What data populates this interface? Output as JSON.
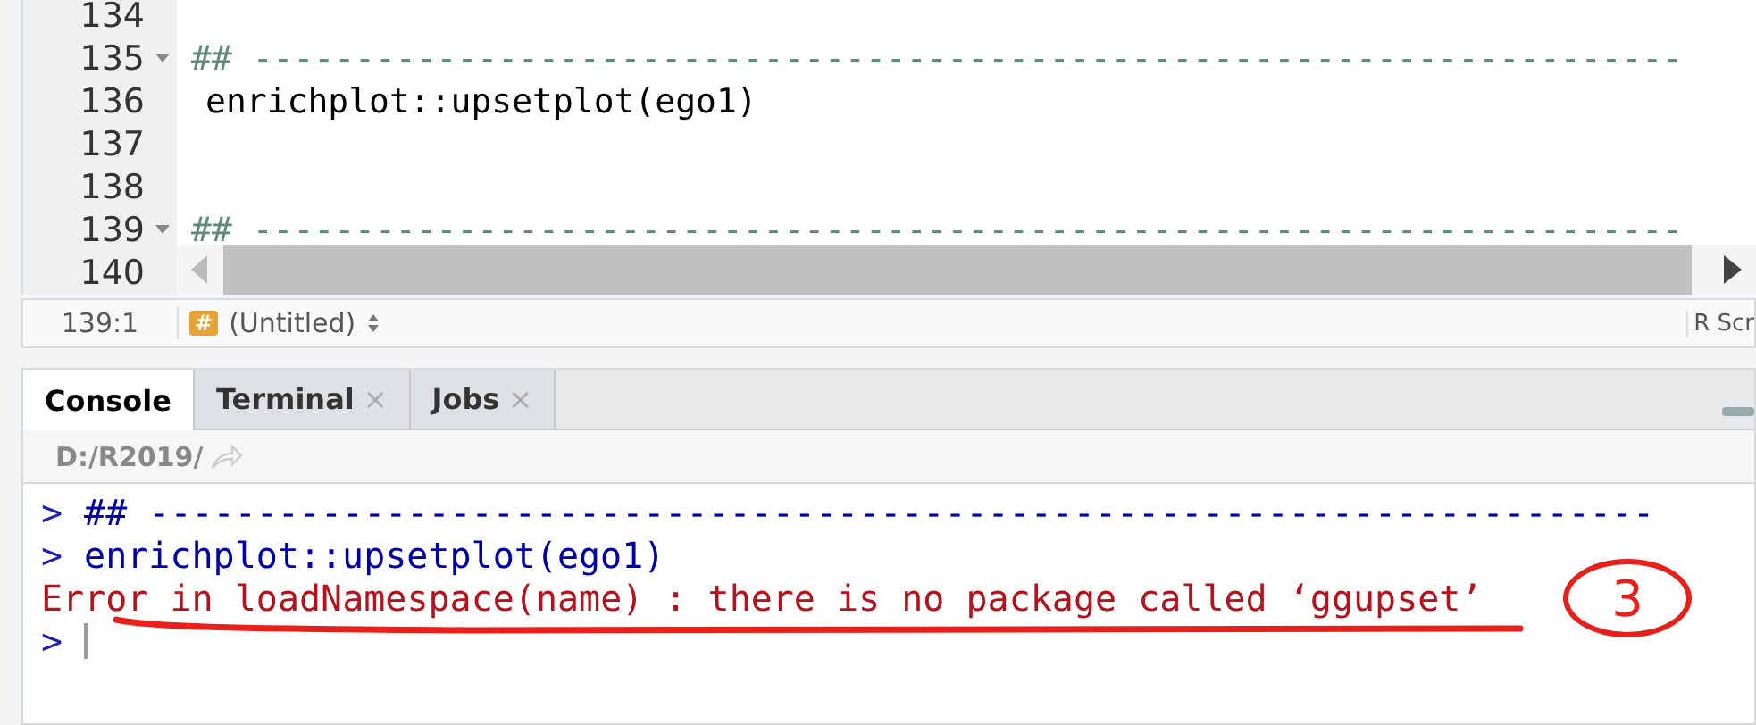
{
  "editor": {
    "lines": [
      {
        "number": "134",
        "foldable": false
      },
      {
        "number": "135",
        "foldable": true,
        "code": "## ----------------------------------------------------------------------",
        "kind": "comment"
      },
      {
        "number": "136",
        "foldable": false,
        "code": "enrichplot::upsetplot(ego1)",
        "kind": "code"
      },
      {
        "number": "137",
        "foldable": false
      },
      {
        "number": "138",
        "foldable": false
      },
      {
        "number": "139",
        "foldable": true,
        "code": "## ----------------------------------------------------------------------",
        "kind": "comment"
      },
      {
        "number": "140",
        "foldable": false
      }
    ]
  },
  "status_bar": {
    "position": "139:1",
    "scope_icon": "#",
    "scope": "(Untitled)",
    "file_type": "R Scr"
  },
  "console": {
    "tabs": [
      {
        "label": "Console",
        "selected": true,
        "closable": false
      },
      {
        "label": "Terminal",
        "selected": false,
        "closable": true
      },
      {
        "label": "Jobs",
        "selected": false,
        "closable": true
      }
    ],
    "close_glyph": "×",
    "path": "D:/R2019/",
    "lines": [
      {
        "prompt": ">",
        "text": "## ----------------------------------------------------------------------",
        "kind": "input"
      },
      {
        "prompt": ">",
        "text": "enrichplot::upsetplot(ego1)",
        "kind": "input"
      },
      {
        "text": "Error in loadNamespace(name) : there is no package called ‘ggupset’",
        "kind": "error"
      },
      {
        "prompt": ">",
        "kind": "cursor"
      }
    ]
  },
  "annotation": {
    "label": "3"
  }
}
